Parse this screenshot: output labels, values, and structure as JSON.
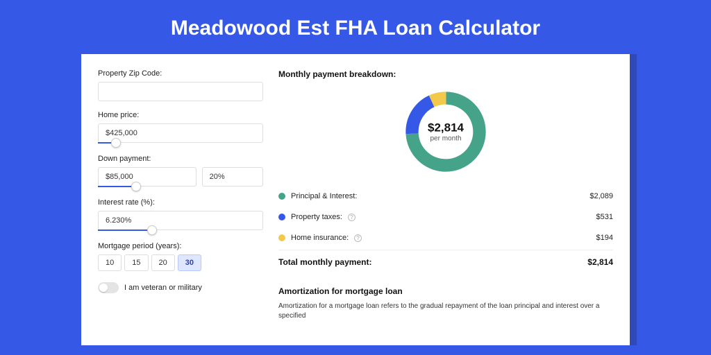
{
  "title": "Meadowood Est FHA Loan Calculator",
  "form": {
    "zip": {
      "label": "Property Zip Code:",
      "value": ""
    },
    "homePrice": {
      "label": "Home price:",
      "value": "$425,000",
      "sliderPct": 8
    },
    "downPayment": {
      "label": "Down payment:",
      "amount": "$85,000",
      "pct": "20%",
      "sliderPct": 20
    },
    "interest": {
      "label": "Interest rate (%):",
      "value": "6.230%",
      "sliderPct": 30
    },
    "period": {
      "label": "Mortgage period (years):",
      "options": [
        "10",
        "15",
        "20",
        "30"
      ],
      "active": 3
    },
    "veteran": {
      "label": "I am veteran or military",
      "on": false
    }
  },
  "breakdown": {
    "heading": "Monthly payment breakdown:",
    "donut": {
      "amount": "$2,814",
      "sub": "per month"
    },
    "rows": [
      {
        "color": "green",
        "label": "Principal & Interest:",
        "info": false,
        "value": "$2,089"
      },
      {
        "color": "blue",
        "label": "Property taxes:",
        "info": true,
        "value": "$531"
      },
      {
        "color": "yellow",
        "label": "Home insurance:",
        "info": true,
        "value": "$194"
      }
    ],
    "total": {
      "label": "Total monthly payment:",
      "value": "$2,814"
    }
  },
  "amortization": {
    "heading": "Amortization for mortgage loan",
    "text": "Amortization for a mortgage loan refers to the gradual repayment of the loan principal and interest over a specified"
  },
  "chart_data": {
    "type": "pie",
    "title": "Monthly payment breakdown",
    "series": [
      {
        "name": "Principal & Interest",
        "value": 2089,
        "color": "#45a38a"
      },
      {
        "name": "Property taxes",
        "value": 531,
        "color": "#3558e6"
      },
      {
        "name": "Home insurance",
        "value": 194,
        "color": "#f3c94b"
      }
    ],
    "total": 2814
  }
}
